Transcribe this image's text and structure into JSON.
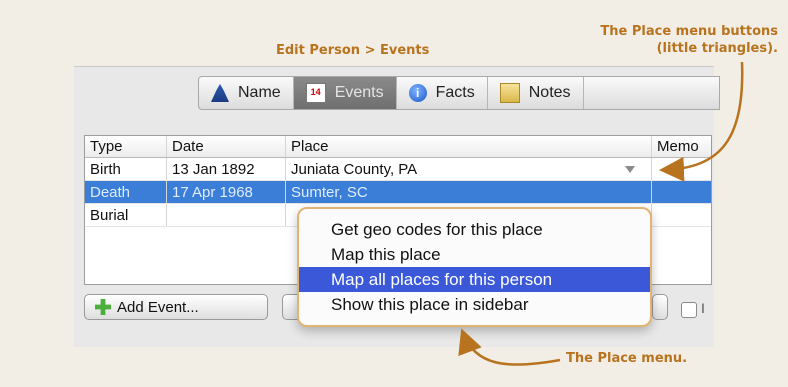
{
  "annotations": {
    "title": "Edit Person > Events",
    "menu_buttons_line1": "The Place menu buttons",
    "menu_buttons_line2": "(little triangles).",
    "place_menu": "The Place menu."
  },
  "tabs": [
    {
      "label": "Name",
      "icon": "person-icon"
    },
    {
      "label": "Events",
      "icon": "calendar-icon",
      "icon_text": "14",
      "active": true
    },
    {
      "label": "Facts",
      "icon": "info-icon",
      "icon_text": "i"
    },
    {
      "label": "Notes",
      "icon": "notepad-icon"
    }
  ],
  "table": {
    "headers": [
      "Type",
      "Date",
      "Place",
      "Memo"
    ],
    "rows": [
      {
        "type": "Birth",
        "date": "13 Jan 1892",
        "place": "Juniata County, PA",
        "memo": ""
      },
      {
        "type": "Death",
        "date": "17 Apr 1968",
        "place": "Sumter, SC",
        "memo": ""
      },
      {
        "type": "Burial",
        "date": "",
        "place": "",
        "memo": ""
      }
    ]
  },
  "buttons": {
    "add_event": "Add Event...",
    "checkbox_label": "I"
  },
  "place_menu": {
    "items": [
      "Get geo codes for this place",
      "Map this place",
      "Map all places for this person",
      "Show this place in sidebar"
    ],
    "highlighted_index": 2
  },
  "colors": {
    "annotation": "#b8731e",
    "selection": "#3a7ed8",
    "menu_highlight": "#3a58d8",
    "menu_border": "#e2b474"
  }
}
